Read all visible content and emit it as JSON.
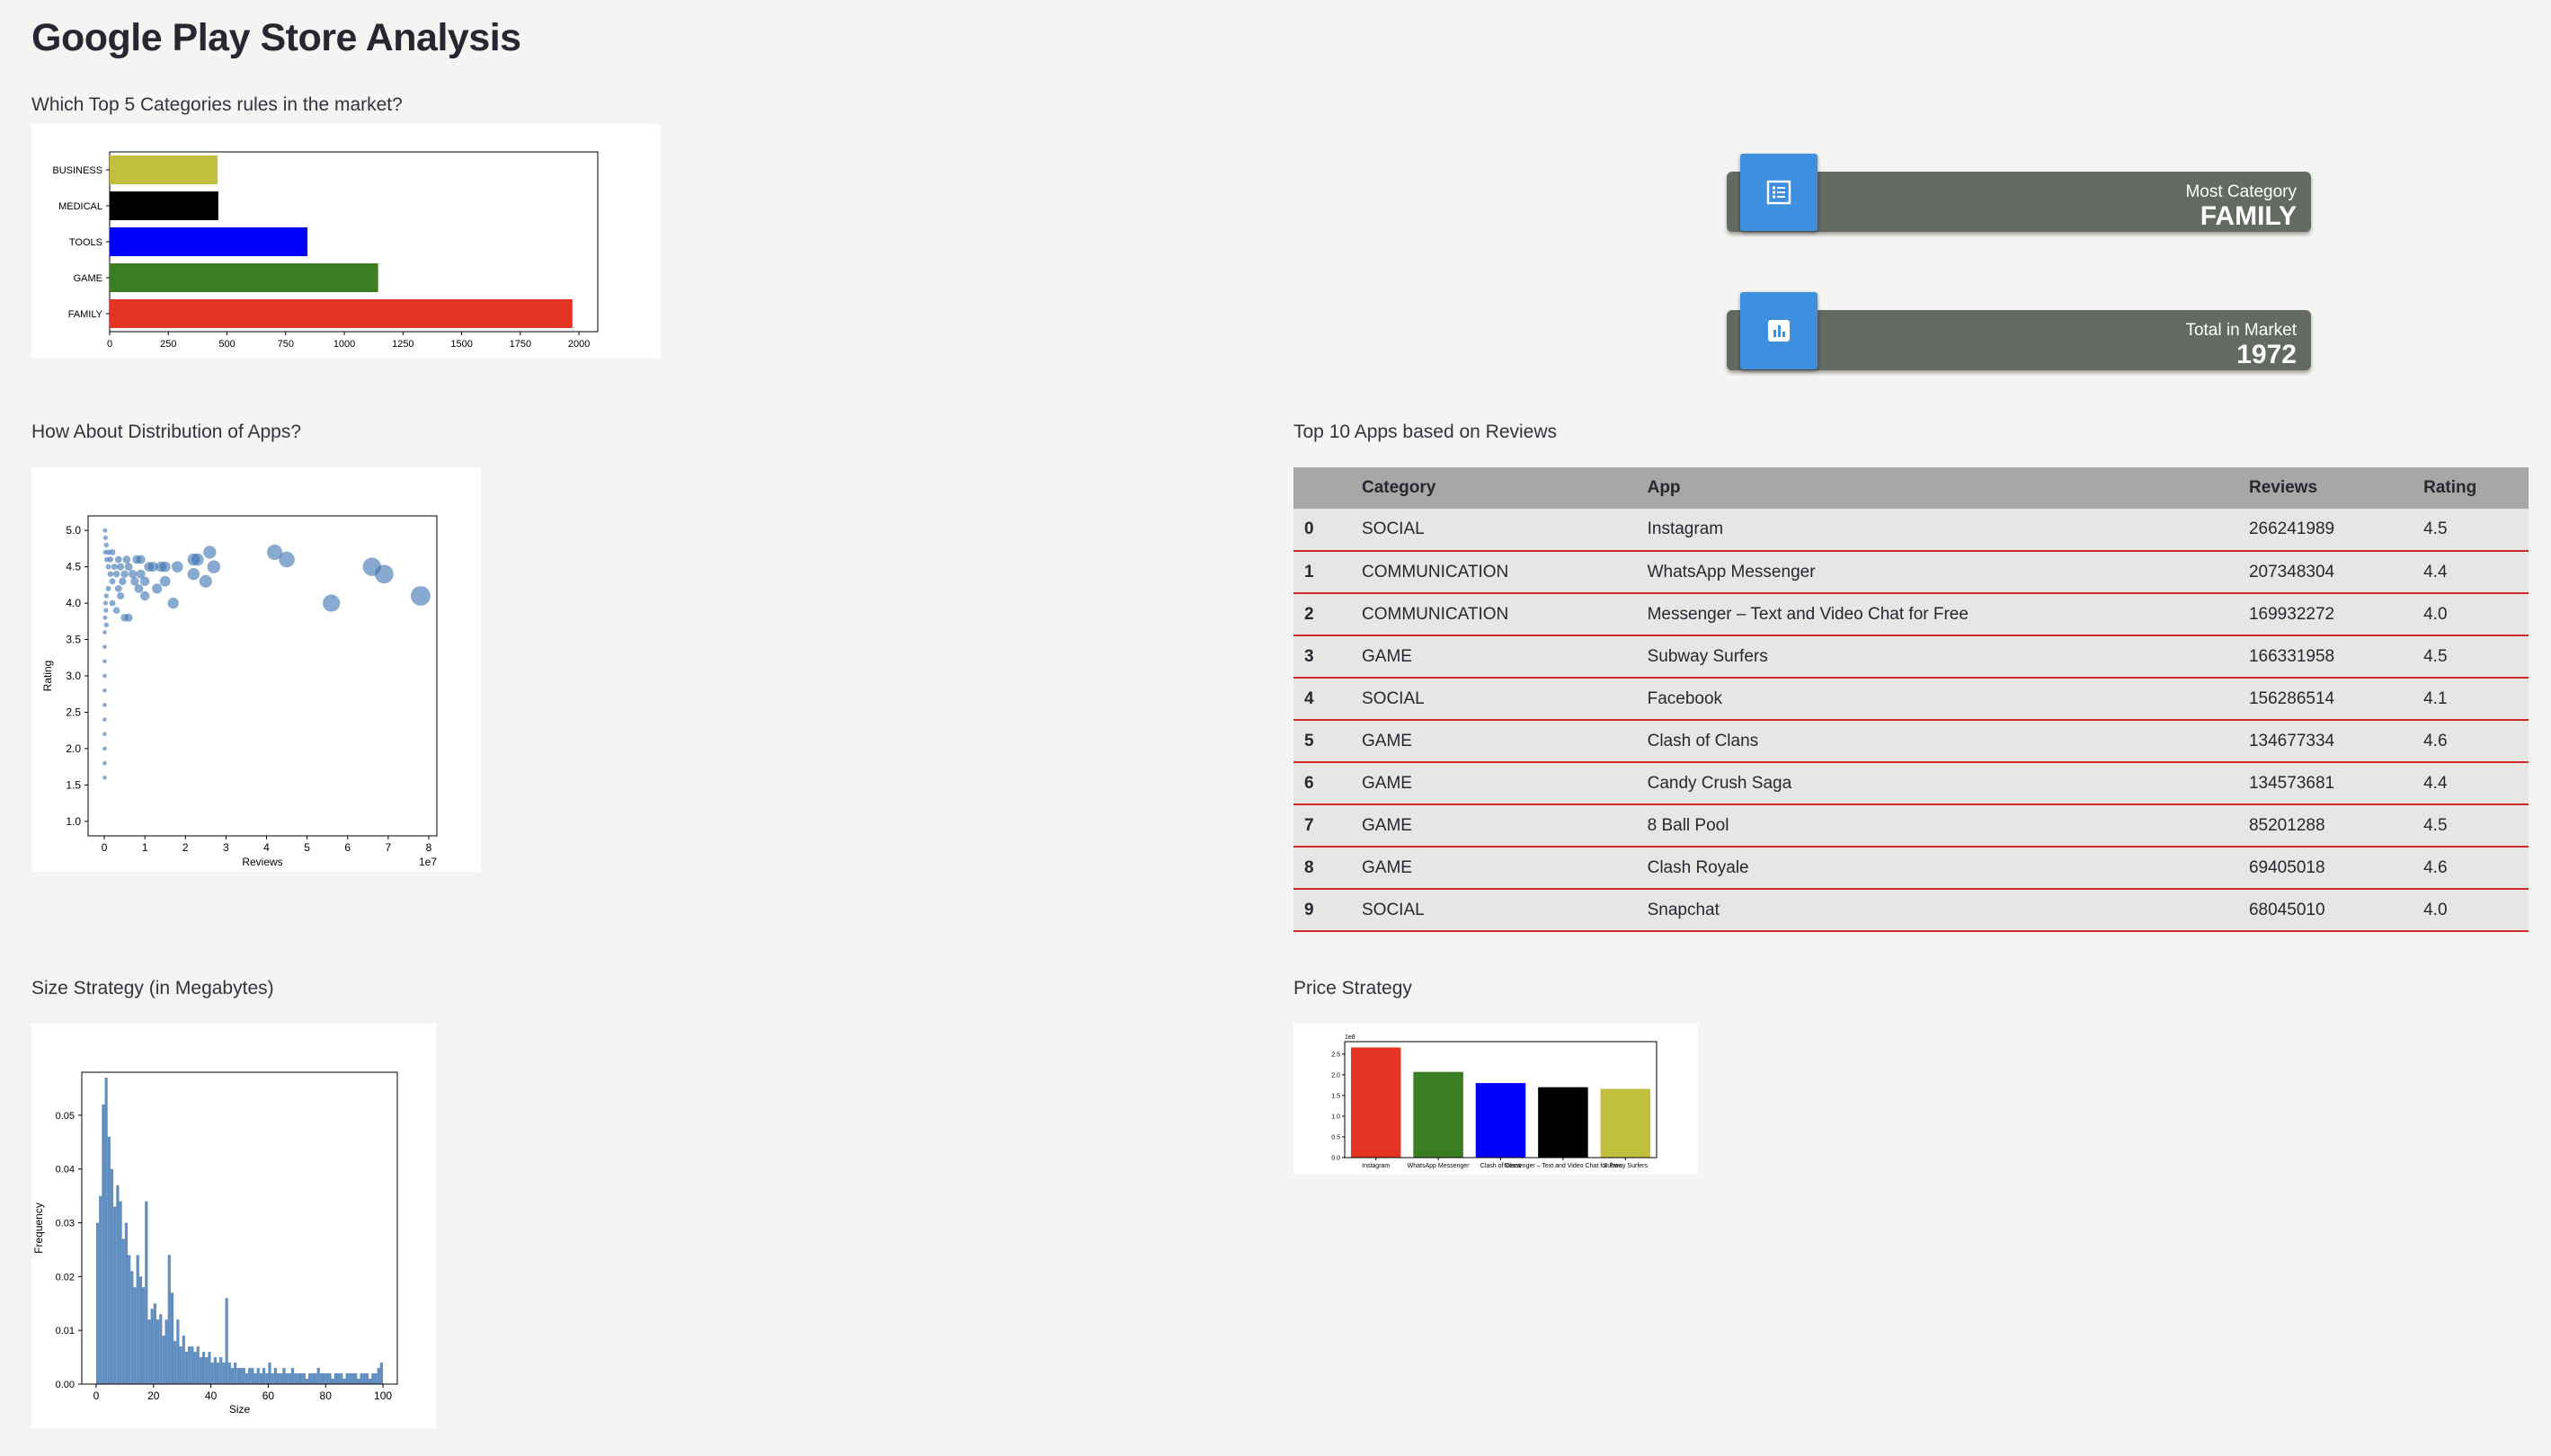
{
  "page": {
    "title": "Google Play Store Analysis",
    "sections": {
      "top_categories": "Which Top 5 Categories rules in the market?",
      "distribution": "How About Distribution of Apps?",
      "top_reviews": "Top 10 Apps based on Reviews",
      "size_strategy": "Size Strategy (in Megabytes)",
      "price_strategy": "Price Strategy"
    }
  },
  "metrics": [
    {
      "label": "Most Category",
      "value": "FAMILY",
      "icon": "list-icon",
      "icon_color": "#3f8fe0"
    },
    {
      "label": "Total in Market",
      "value": "1972",
      "icon": "bar-chart-icon",
      "icon_color": "#3f8fe0"
    }
  ],
  "table": {
    "columns": [
      "",
      "Category",
      "App",
      "Reviews",
      "Rating"
    ],
    "rows": [
      [
        "0",
        "SOCIAL",
        "Instagram",
        "266241989",
        "4.5"
      ],
      [
        "1",
        "COMMUNICATION",
        "WhatsApp Messenger",
        "207348304",
        "4.4"
      ],
      [
        "2",
        "COMMUNICATION",
        "Messenger – Text and Video Chat for Free",
        "169932272",
        "4.0"
      ],
      [
        "3",
        "GAME",
        "Subway Surfers",
        "166331958",
        "4.5"
      ],
      [
        "4",
        "SOCIAL",
        "Facebook",
        "156286514",
        "4.1"
      ],
      [
        "5",
        "GAME",
        "Clash of Clans",
        "134677334",
        "4.6"
      ],
      [
        "6",
        "GAME",
        "Candy Crush Saga",
        "134573681",
        "4.4"
      ],
      [
        "7",
        "GAME",
        "8 Ball Pool",
        "85201288",
        "4.5"
      ],
      [
        "8",
        "GAME",
        "Clash Royale",
        "69405018",
        "4.6"
      ],
      [
        "9",
        "SOCIAL",
        "Snapchat",
        "68045010",
        "4.0"
      ]
    ]
  },
  "chart_data": [
    {
      "id": "top-categories",
      "type": "bar",
      "orientation": "horizontal",
      "categories": [
        "FAMILY",
        "GAME",
        "TOOLS",
        "MEDICAL",
        "BUSINESS"
      ],
      "values": [
        1972,
        1144,
        843,
        463,
        460
      ],
      "colors": [
        "#e63424",
        "#3a7d22",
        "#0000ff",
        "#000000",
        "#c1bf3e"
      ],
      "xlim": [
        0,
        2080
      ],
      "xticks": [
        0,
        250,
        500,
        750,
        1000,
        1250,
        1500,
        1750,
        2000
      ]
    },
    {
      "id": "distribution",
      "type": "scatter",
      "xlabel": "Reviews",
      "ylabel": "Rating",
      "x_scale_label": "1e7",
      "xlim": [
        -0.4,
        8.2
      ],
      "ylim": [
        0.8,
        5.2
      ],
      "xticks": [
        0,
        1,
        2,
        3,
        4,
        5,
        6,
        7,
        8
      ],
      "yticks": [
        1.0,
        1.5,
        2.0,
        2.5,
        3.0,
        3.5,
        4.0,
        4.5,
        5.0
      ],
      "color": "#3a72b0",
      "points": [
        [
          0.02,
          5.0
        ],
        [
          0.03,
          4.9
        ],
        [
          0.05,
          4.8
        ],
        [
          0.02,
          4.7
        ],
        [
          0.06,
          4.6
        ],
        [
          0.1,
          4.5
        ],
        [
          0.15,
          4.4
        ],
        [
          0.2,
          4.3
        ],
        [
          0.1,
          4.2
        ],
        [
          0.05,
          4.1
        ],
        [
          0.03,
          4.0
        ],
        [
          0.04,
          3.9
        ],
        [
          0.02,
          3.8
        ],
        [
          0.01,
          3.6
        ],
        [
          0.01,
          3.4
        ],
        [
          0.01,
          3.2
        ],
        [
          0.01,
          3.0
        ],
        [
          0.01,
          2.8
        ],
        [
          0.01,
          2.6
        ],
        [
          0.01,
          2.4
        ],
        [
          0.01,
          2.2
        ],
        [
          0.01,
          2.0
        ],
        [
          0.01,
          1.8
        ],
        [
          0.01,
          1.6
        ],
        [
          0.05,
          3.7
        ],
        [
          0.1,
          4.7
        ],
        [
          0.15,
          4.6
        ],
        [
          0.2,
          4.7
        ],
        [
          0.25,
          4.5
        ],
        [
          0.3,
          4.4
        ],
        [
          0.35,
          4.6
        ],
        [
          0.4,
          4.5
        ],
        [
          0.45,
          4.3
        ],
        [
          0.5,
          4.4
        ],
        [
          0.55,
          4.6
        ],
        [
          0.6,
          4.5
        ],
        [
          0.7,
          4.4
        ],
        [
          0.75,
          4.3
        ],
        [
          0.8,
          4.6
        ],
        [
          0.85,
          4.2
        ],
        [
          0.9,
          4.4
        ],
        [
          1.0,
          4.3
        ],
        [
          1.1,
          4.5
        ],
        [
          1.2,
          4.5
        ],
        [
          1.3,
          4.2
        ],
        [
          1.4,
          4.5
        ],
        [
          1.5,
          4.5
        ],
        [
          1.7,
          4.0
        ],
        [
          1.8,
          4.5
        ],
        [
          2.2,
          4.4
        ],
        [
          2.3,
          4.6
        ],
        [
          2.5,
          4.3
        ],
        [
          2.6,
          4.7
        ],
        [
          2.7,
          4.5
        ],
        [
          1.0,
          4.1
        ],
        [
          0.6,
          3.8
        ],
        [
          0.3,
          3.9
        ],
        [
          0.2,
          4.0
        ],
        [
          0.4,
          4.1
        ],
        [
          0.5,
          3.8
        ],
        [
          4.2,
          4.7
        ],
        [
          4.5,
          4.6
        ],
        [
          5.6,
          4.0
        ],
        [
          6.6,
          4.5
        ],
        [
          6.9,
          4.4
        ],
        [
          7.8,
          4.1
        ],
        [
          2.2,
          4.6
        ],
        [
          1.5,
          4.3
        ],
        [
          0.9,
          4.6
        ],
        [
          0.35,
          4.2
        ]
      ]
    },
    {
      "id": "size-strategy",
      "type": "bar",
      "subtype": "histogram",
      "xlabel": "Size",
      "ylabel": "Frequency",
      "xlim": [
        -5,
        105
      ],
      "ylim": [
        0,
        0.058
      ],
      "xticks": [
        0,
        20,
        40,
        60,
        80,
        100
      ],
      "yticks": [
        0.0,
        0.01,
        0.02,
        0.03,
        0.04,
        0.05
      ],
      "ytick_labels": [
        "0.00",
        "0.01",
        "0.02",
        "0.03",
        "0.04",
        "0.05"
      ],
      "color": "#3a72b0",
      "bin_width": 1,
      "values": [
        0.03,
        0.035,
        0.052,
        0.057,
        0.046,
        0.04,
        0.033,
        0.037,
        0.034,
        0.027,
        0.03,
        0.024,
        0.021,
        0.018,
        0.024,
        0.02,
        0.018,
        0.034,
        0.012,
        0.014,
        0.015,
        0.012,
        0.013,
        0.009,
        0.012,
        0.024,
        0.017,
        0.008,
        0.012,
        0.007,
        0.009,
        0.006,
        0.007,
        0.007,
        0.006,
        0.007,
        0.005,
        0.006,
        0.005,
        0.006,
        0.004,
        0.005,
        0.004,
        0.005,
        0.004,
        0.016,
        0.004,
        0.003,
        0.004,
        0.003,
        0.003,
        0.003,
        0.002,
        0.003,
        0.003,
        0.002,
        0.003,
        0.002,
        0.003,
        0.002,
        0.004,
        0.002,
        0.003,
        0.002,
        0.002,
        0.003,
        0.002,
        0.002,
        0.003,
        0.002,
        0.002,
        0.002,
        0.002,
        0.001,
        0.002,
        0.002,
        0.002,
        0.003,
        0.002,
        0.002,
        0.002,
        0.002,
        0.001,
        0.002,
        0.002,
        0.002,
        0.001,
        0.002,
        0.002,
        0.002,
        0.002,
        0.001,
        0.002,
        0.002,
        0.002,
        0.001,
        0.002,
        0.002,
        0.003,
        0.004
      ]
    },
    {
      "id": "price-strategy",
      "type": "bar",
      "categories": [
        "Instagram",
        "WhatsApp Messenger",
        "Clash of Clans",
        "Messenger – Text and Video Chat for Free",
        "Subway Surfers"
      ],
      "values": [
        2.66,
        2.07,
        1.8,
        1.7,
        1.66
      ],
      "y_scale_label": "1e8",
      "colors": [
        "#e63424",
        "#3a7d22",
        "#0000ff",
        "#000000",
        "#c1bf3e"
      ],
      "ylim": [
        0,
        2.8
      ],
      "yticks": [
        0.0,
        0.5,
        1.0,
        1.5,
        2.0,
        2.5
      ]
    }
  ]
}
